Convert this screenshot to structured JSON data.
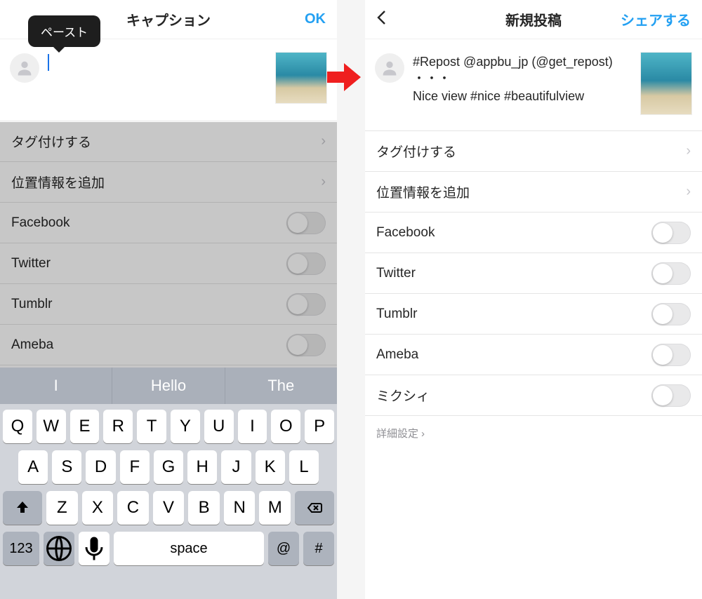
{
  "left": {
    "header": {
      "title": "キャプション",
      "ok": "OK"
    },
    "paste_popup": "ペースト",
    "caption": "",
    "rows": {
      "tag": "タグ付けする",
      "location": "位置情報を追加",
      "share": [
        "Facebook",
        "Twitter",
        "Tumblr",
        "Ameba"
      ]
    },
    "keyboard": {
      "suggestions": [
        "I",
        "Hello",
        "The"
      ],
      "row1": [
        "Q",
        "W",
        "E",
        "R",
        "T",
        "Y",
        "U",
        "I",
        "O",
        "P"
      ],
      "row2": [
        "A",
        "S",
        "D",
        "F",
        "G",
        "H",
        "J",
        "K",
        "L"
      ],
      "row3": [
        "Z",
        "X",
        "C",
        "V",
        "B",
        "N",
        "M"
      ],
      "numkey": "123",
      "space": "space",
      "at": "@",
      "hash": "#"
    }
  },
  "right": {
    "header": {
      "back": "‹",
      "title": "新規投稿",
      "share": "シェアする"
    },
    "caption": "#Repost @appbu_jp (@get_repost)\n・・・\nNice view #nice #beautifulview",
    "rows": {
      "tag": "タグ付けする",
      "location": "位置情報を追加",
      "share": [
        "Facebook",
        "Twitter",
        "Tumblr",
        "Ameba",
        "ミクシィ"
      ]
    },
    "advanced": "詳細設定"
  }
}
